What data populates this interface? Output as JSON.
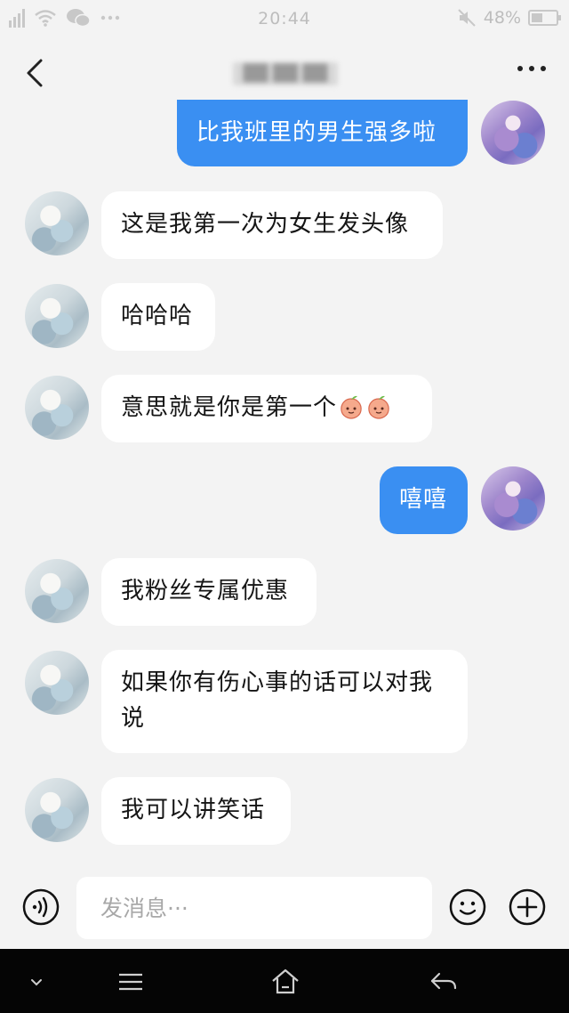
{
  "status_bar": {
    "time": "20:44",
    "battery": "48%",
    "battery_level": 0.48,
    "icons": [
      "signal-icon",
      "wifi-icon",
      "wechat-icon",
      "more-dots-icon",
      "mute-icon",
      "battery-icon"
    ]
  },
  "header": {
    "title": "██ ██ ██",
    "back_icon": "back-chevron-icon",
    "more_icon": "more-icon"
  },
  "messages": [
    {
      "sender": "me",
      "text": "比我班里的男生强多啦"
    },
    {
      "sender": "them",
      "text": "这是我第一次为女生发头像"
    },
    {
      "sender": "them",
      "text": "哈哈哈"
    },
    {
      "sender": "them",
      "text": "意思就是你是第一个",
      "emojis": [
        "peach-emoji",
        "peach-emoji"
      ]
    },
    {
      "sender": "me",
      "text": "嘻嘻"
    },
    {
      "sender": "them",
      "text": "我粉丝专属优惠"
    },
    {
      "sender": "them",
      "text": "如果你有伤心事的话可以对我说"
    },
    {
      "sender": "them",
      "text": "我可以讲笑话"
    }
  ],
  "input": {
    "placeholder": "发消息···",
    "value": "",
    "voice_icon": "voice-icon",
    "emoji_icon": "emoji-icon",
    "plus_icon": "plus-icon"
  },
  "system_nav": {
    "icons": [
      "collapse-icon",
      "menu-icon",
      "home-icon",
      "back-icon"
    ]
  },
  "colors": {
    "background": "#f3f3f3",
    "my_bubble": "#3a8ff2",
    "their_bubble": "#ffffff",
    "system_nav": "#050505"
  }
}
